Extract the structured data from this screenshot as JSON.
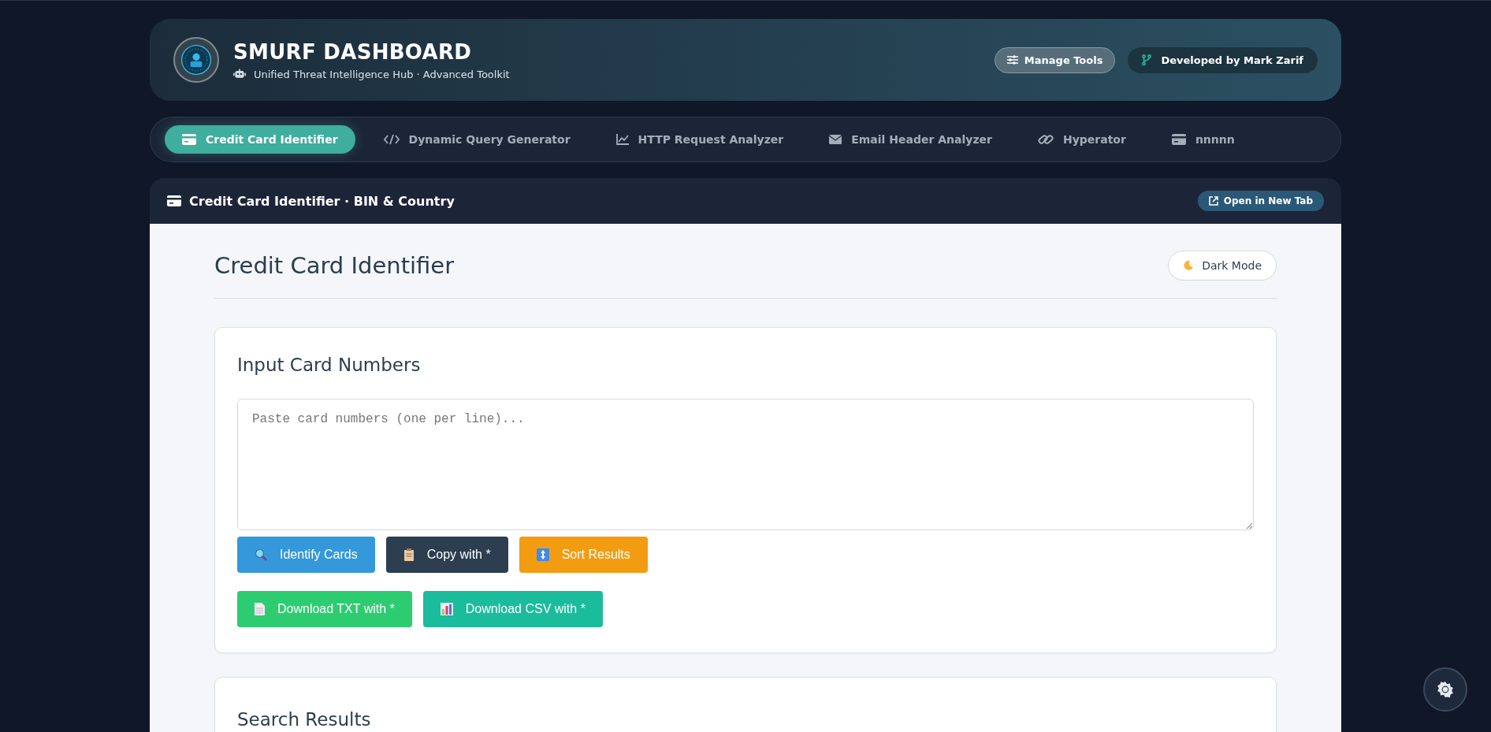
{
  "header": {
    "title": "SMURF DASHBOARD",
    "subtitle": "Unified Threat Intelligence Hub · Advanced Toolkit",
    "manage_button": "Manage Tools",
    "credit": "Developed by **Mark Zarif**"
  },
  "tabs": [
    {
      "label": "Credit Card Identifier",
      "selected": true
    },
    {
      "label": "Dynamic Query Generator",
      "selected": false
    },
    {
      "label": "HTTP Request Analyzer",
      "selected": false
    },
    {
      "label": "Email Header Analyzer",
      "selected": false
    },
    {
      "label": "Hyperator",
      "selected": false
    },
    {
      "label": "nnnnn",
      "selected": false
    }
  ],
  "panel": {
    "title": "Credit Card Identifier · BIN & Country",
    "open_button": "Open in New Tab"
  },
  "page": {
    "title": "Credit Card Identifier",
    "dark_mode_button": "Dark Mode"
  },
  "input_card": {
    "title": "Input Card Numbers",
    "placeholder": "Paste card numbers (one per line)...",
    "button_rows": [
      [
        {
          "label": "Identify Cards",
          "kind": "identify"
        },
        {
          "label": "Copy with *",
          "kind": "copy"
        },
        {
          "label": "Sort Results",
          "kind": "sort"
        }
      ],
      [
        {
          "label": "Download TXT with *",
          "kind": "txt"
        },
        {
          "label": "Download CSV with *",
          "kind": "csv"
        }
      ]
    ]
  },
  "results_card": {
    "title": "Search Results"
  }
}
